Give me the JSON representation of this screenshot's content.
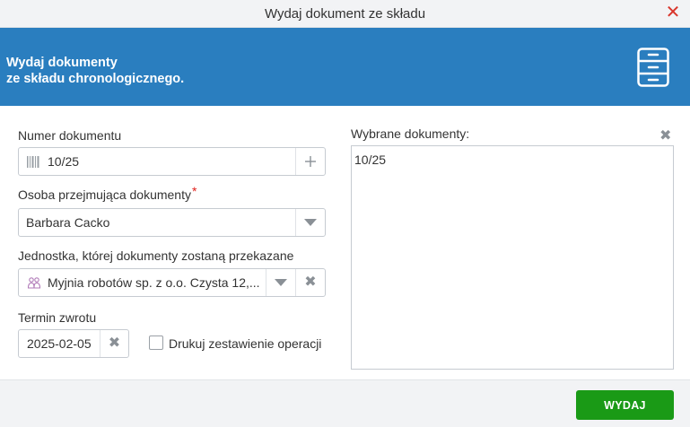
{
  "window": {
    "title": "Wydaj dokument ze składu"
  },
  "banner": {
    "line1": "Wydaj dokumenty",
    "line2": "ze składu chronologicznego."
  },
  "form": {
    "document_number": {
      "label": "Numer dokumentu",
      "value": "10/25"
    },
    "receiver": {
      "label": "Osoba przejmująca dokumenty",
      "required_mark": "*",
      "value": "Barbara Cacko"
    },
    "unit": {
      "label": "Jednostka, której dokumenty zostaną przekazane",
      "value": "Myjnia robotów sp. z o.o. Czysta 12,..."
    },
    "return_date": {
      "label": "Termin zwrotu",
      "value": "2025-02-05"
    },
    "print_summary": {
      "label": "Drukuj zestawienie operacji",
      "checked": false
    }
  },
  "selected": {
    "label": "Wybrane dokumenty:",
    "items_text": "10/25"
  },
  "footer": {
    "issue_label": "WYDAJ"
  },
  "colors": {
    "banner": "#2a7ebf",
    "button": "#1a9a16",
    "close": "#d9352b",
    "required": "#e0201b"
  }
}
